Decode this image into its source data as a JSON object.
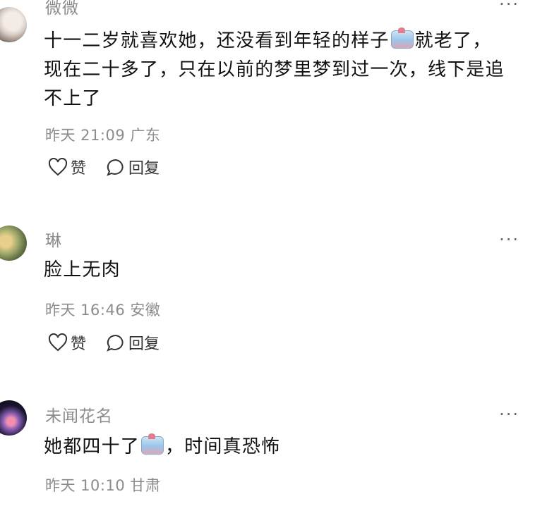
{
  "comments": [
    {
      "author": "微微",
      "text_before_emoji": "十一二岁就喜欢她，还没看到年轻的样子",
      "text_after_emoji": "就老了，",
      "text_line2": "现在二十多了，只在以前的梦里梦到过一次，线下是追",
      "text_line3": "不上了",
      "time": "昨天 21:09",
      "location": "广东",
      "like_label": "赞",
      "reply_label": "回复"
    },
    {
      "author": "琳",
      "text": "脸上无肉",
      "time": "昨天 16:46",
      "location": "安徽",
      "like_label": "赞",
      "reply_label": "回复"
    },
    {
      "author": "未闻花名",
      "text_before_emoji": "她都四十了",
      "text_after_emoji": "，时间真恐怖",
      "time": "昨天 10:10",
      "location": "甘肃"
    }
  ],
  "more_glyph": "···",
  "icons": {
    "like": "heart-outline-icon",
    "reply": "speech-bubble-icon",
    "emoji": "sticker-emoji-icon",
    "more": "more-dots-icon"
  }
}
